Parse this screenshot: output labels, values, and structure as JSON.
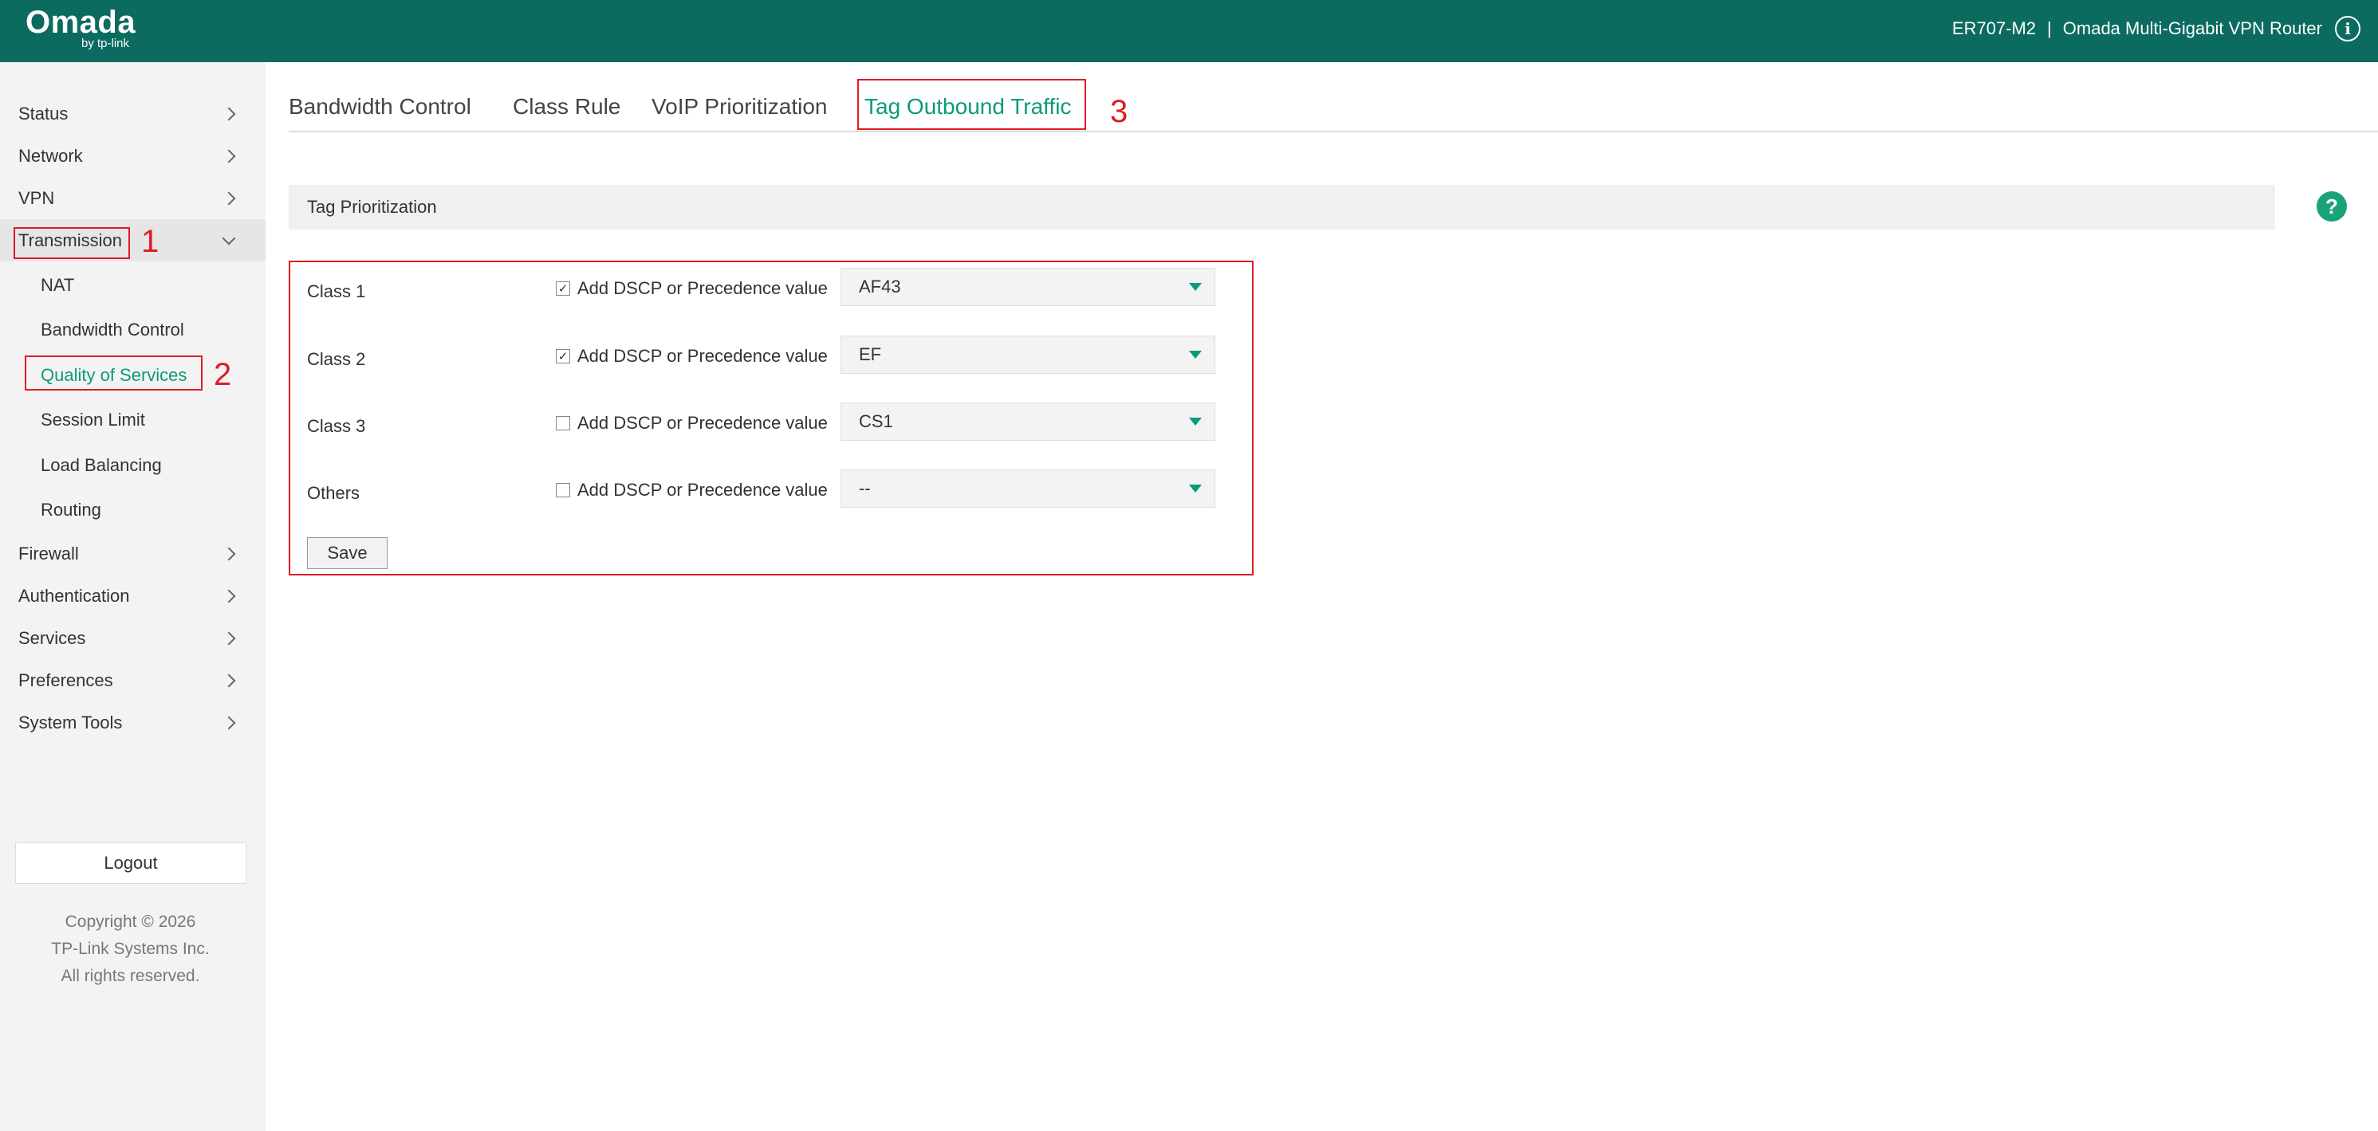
{
  "header": {
    "logo_text": "Omada",
    "logo_sub": "by tp-link",
    "model": "ER707-M2",
    "separator": "|",
    "product_name": "Omada Multi-Gigabit VPN Router",
    "info_icon": "info-icon",
    "bg_color": "#0b6b5f"
  },
  "sidebar": {
    "items": [
      {
        "label": "Status"
      },
      {
        "label": "Network"
      },
      {
        "label": "VPN"
      },
      {
        "label": "Transmission"
      },
      {
        "label": "Firewall"
      },
      {
        "label": "Authentication"
      },
      {
        "label": "Services"
      },
      {
        "label": "Preferences"
      },
      {
        "label": "System Tools"
      }
    ],
    "transmission_sub": [
      {
        "label": "NAT"
      },
      {
        "label": "Bandwidth Control"
      },
      {
        "label": "Quality of Services"
      },
      {
        "label": "Session Limit"
      },
      {
        "label": "Load Balancing"
      },
      {
        "label": "Routing"
      }
    ],
    "logout_label": "Logout",
    "copyright_lines": [
      "Copyright  © 2026",
      "TP-Link Systems Inc.",
      "All rights reserved."
    ]
  },
  "tabs": [
    {
      "label": "Bandwidth Control"
    },
    {
      "label": "Class Rule"
    },
    {
      "label": "VoIP Prioritization"
    },
    {
      "label": "Tag Outbound Traffic"
    }
  ],
  "section": {
    "title": "Tag Prioritization",
    "help_label": "?"
  },
  "classes": [
    {
      "label": "Class 1",
      "checked": true,
      "checkbox_label": "Add DSCP or Precedence value",
      "value": "AF43"
    },
    {
      "label": "Class 2",
      "checked": true,
      "checkbox_label": "Add DSCP or Precedence value",
      "value": "EF"
    },
    {
      "label": "Class 3",
      "checked": false,
      "checkbox_label": "Add DSCP or Precedence value",
      "value": "CS1"
    },
    {
      "label": "Others",
      "checked": false,
      "checkbox_label": "Add DSCP or Precedence value",
      "value": "--"
    }
  ],
  "check_mark": "✓",
  "save_label": "Save",
  "annotations": [
    "1",
    "2",
    "3"
  ],
  "colors": {
    "accent": "#0b9a7a",
    "annotation": "#e01b24"
  }
}
